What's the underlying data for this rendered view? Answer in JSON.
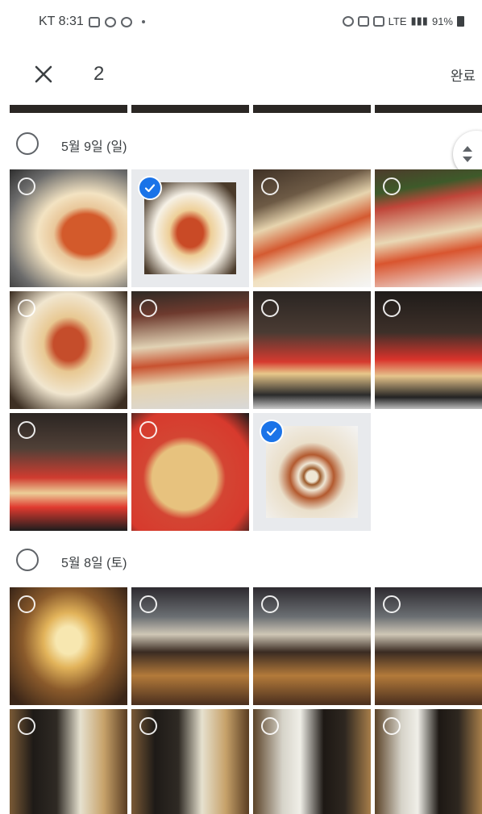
{
  "status": {
    "carrier_time": "KT 8:31",
    "network": "LTE",
    "battery": "91%"
  },
  "toolbar": {
    "selected_count": "2",
    "done_label": "완료"
  },
  "sections": [
    {
      "date": "5월 9일 (일)"
    },
    {
      "date": "5월 8일 (토)"
    }
  ],
  "icons": {
    "close": "close-icon",
    "check": "check-icon",
    "scroll": "scroll-handle-icon"
  },
  "colors": {
    "accent": "#1a73e8",
    "text": "#3c4043"
  }
}
